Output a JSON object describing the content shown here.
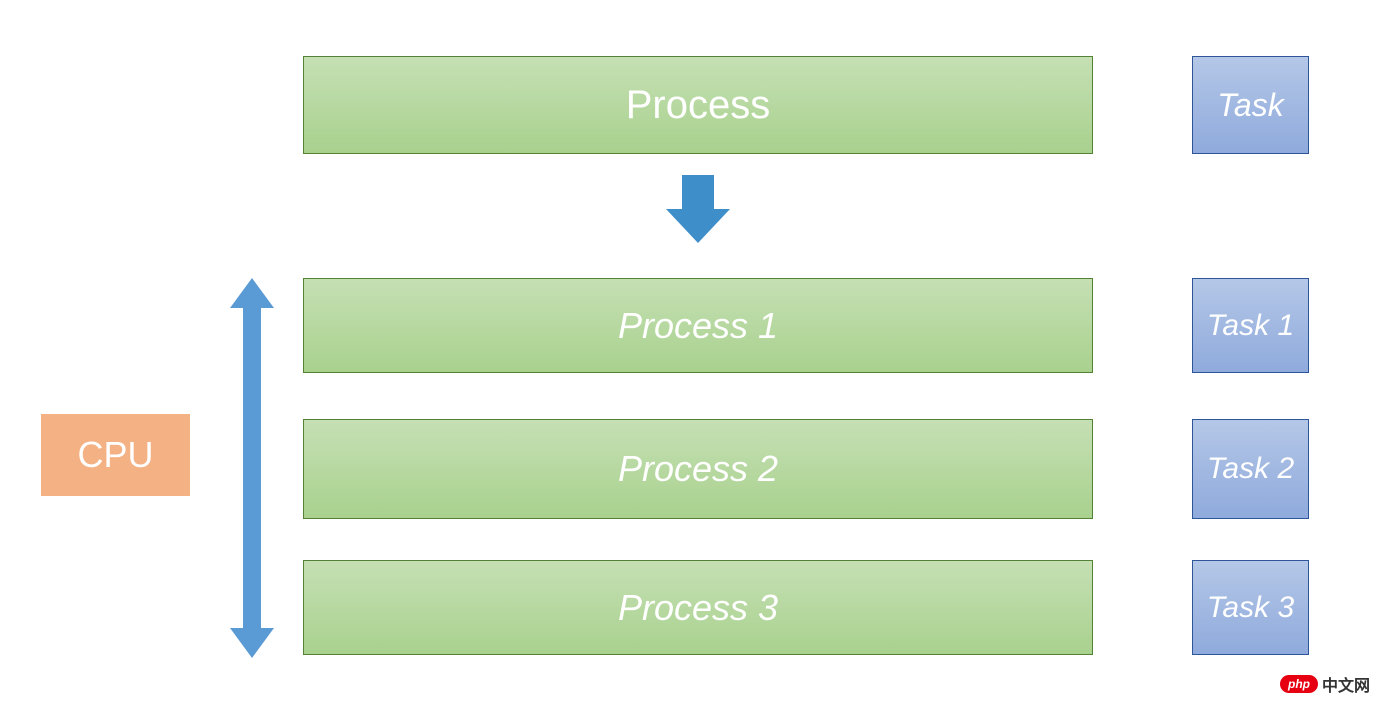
{
  "diagram": {
    "cpu_label": "CPU",
    "process_top": "Process",
    "task_top": "Task",
    "processes": [
      {
        "label": "Process 1"
      },
      {
        "label": "Process 2"
      },
      {
        "label": "Process 3"
      }
    ],
    "tasks": [
      {
        "label": "Task 1"
      },
      {
        "label": "Task 2"
      },
      {
        "label": "Task 3"
      }
    ]
  },
  "colors": {
    "process_fill_top": "#c5e0b4",
    "process_fill_bottom": "#a9d18e",
    "process_border": "#548235",
    "task_fill_top": "#b4c7e7",
    "task_fill_bottom": "#8faadc",
    "task_border": "#2e5597",
    "cpu_fill": "#f4b183",
    "arrow_blue": "#3e8ec9",
    "arrow_light": "#5b9bd5"
  },
  "watermark": {
    "logo_text": "php",
    "site_text": "中文网"
  }
}
